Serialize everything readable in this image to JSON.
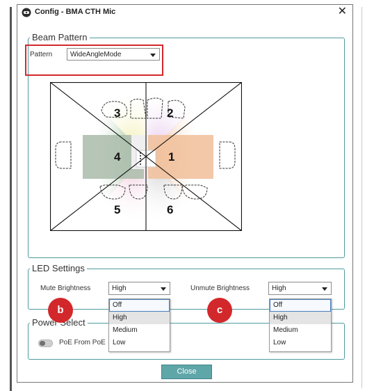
{
  "window": {
    "title": "Config - BMA CTH Mic",
    "close_glyph": "✕"
  },
  "beam_pattern": {
    "legend": "Beam Pattern",
    "pattern_label": "Pattern",
    "pattern_value": "WideAngleMode",
    "zones": [
      "1",
      "2",
      "3",
      "4",
      "5",
      "6"
    ]
  },
  "led_settings": {
    "legend": "LED Settings",
    "mute_label": "Mute Brightness",
    "mute_value": "High",
    "mute_options": [
      "Off",
      "High",
      "Medium",
      "Low"
    ],
    "unmute_label": "Unmute Brightness",
    "unmute_value": "High",
    "unmute_options": [
      "Off",
      "High",
      "Medium",
      "Low"
    ]
  },
  "power_select": {
    "legend": "Power Select",
    "poe_label": "PoE From PoE"
  },
  "badges": {
    "b": "b",
    "c": "c"
  },
  "footer": {
    "close_label": "Close"
  },
  "icons": {
    "app": "microphone-config-icon",
    "dropdown": "chevron-down-icon"
  },
  "colors": {
    "accent": "#5fa6a9",
    "group_border": "#4e9b9e",
    "highlight": "#d3282b",
    "zone1": "#f3b88c",
    "zone2": "#e6c8ee",
    "zone3": "#f2eeaa",
    "zone4": "#8cb88c",
    "zone5": "#f2c9dc",
    "zone6": "#cfcfcf"
  }
}
